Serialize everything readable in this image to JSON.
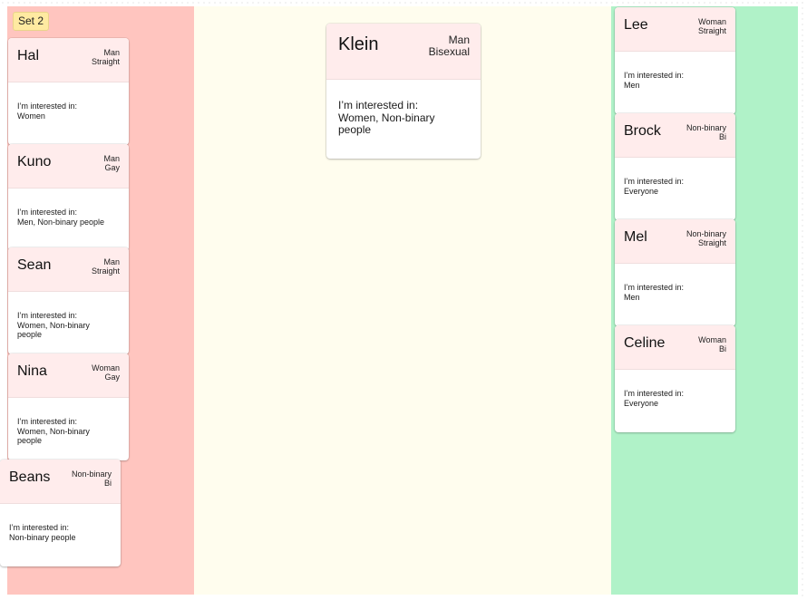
{
  "colors": {
    "left_column": "#ffc5bf",
    "middle_column": "#fffdee",
    "right_column": "#b0f2c8",
    "card_header": "#ffecec",
    "card_body": "#ffffff",
    "badge_bg": "#ffeaa1"
  },
  "set_label": "Set 2",
  "interest_prefix": "I’m interested in:",
  "left_cards": [
    {
      "name": "Hal",
      "gender": "Man",
      "orientation": "Straight",
      "interest_lines": [
        "Women"
      ]
    },
    {
      "name": "Kuno",
      "gender": "Man",
      "orientation": "Gay",
      "interest_lines": [
        "Men, Non-binary people"
      ]
    },
    {
      "name": "Sean",
      "gender": "Man",
      "orientation": "Straight",
      "interest_lines": [
        "Women, Non-binary",
        "people"
      ]
    },
    {
      "name": "Nina",
      "gender": "Woman",
      "orientation": "Gay",
      "interest_lines": [
        "Women, Non-binary",
        "people"
      ]
    },
    {
      "name": "Beans",
      "gender": "Non-binary",
      "orientation": "Bi",
      "interest_lines": [
        "Non-binary people"
      ]
    }
  ],
  "middle_card": {
    "name": "Klein",
    "gender": "Man",
    "orientation": "Bisexual",
    "interest_lines": [
      "Women, Non-binary",
      "people"
    ]
  },
  "right_cards": [
    {
      "name": "Lee",
      "gender": "Woman",
      "orientation": "Straight",
      "interest_lines": [
        "Men"
      ]
    },
    {
      "name": "Brock",
      "gender": "Non-binary",
      "orientation": "Bi",
      "interest_lines": [
        "Everyone"
      ]
    },
    {
      "name": "Mel",
      "gender": "Non-binary",
      "orientation": "Straight",
      "interest_lines": [
        "Men"
      ]
    },
    {
      "name": "Celine",
      "gender": "Woman",
      "orientation": "Bi",
      "interest_lines": [
        "Everyone"
      ]
    }
  ]
}
